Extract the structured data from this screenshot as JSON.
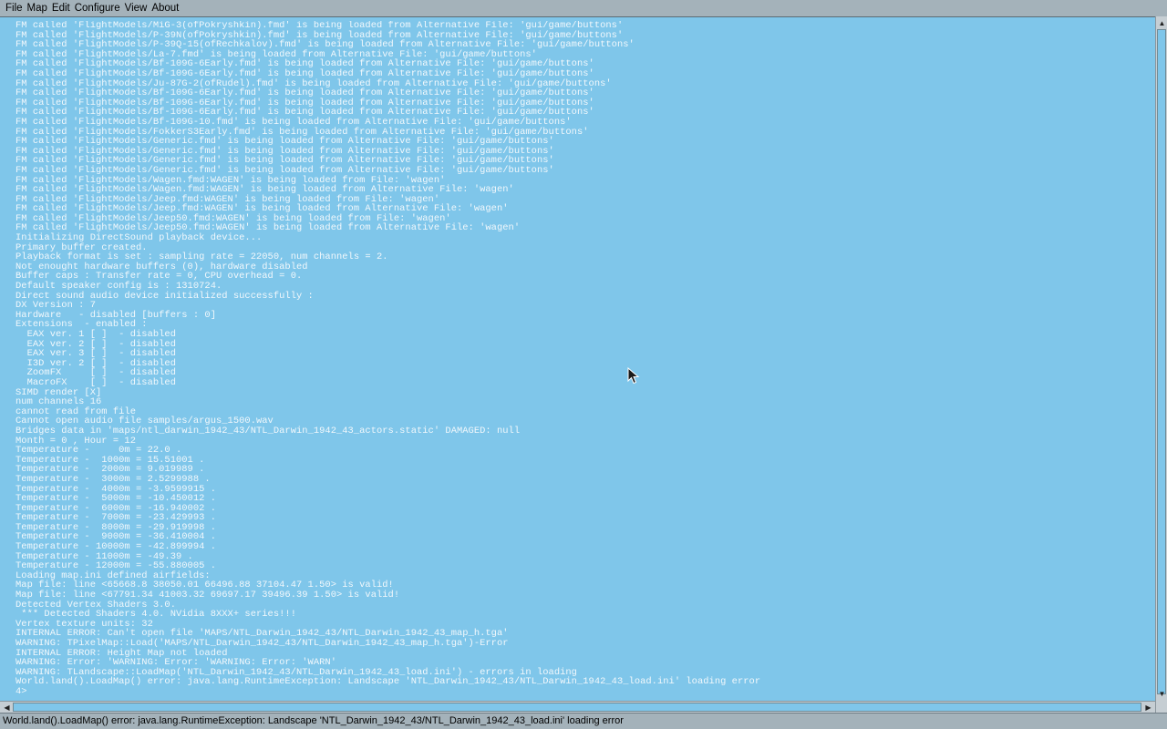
{
  "menu": [
    "File",
    "Map",
    "Edit",
    "Configure",
    "View",
    "About"
  ],
  "console": {
    "lines": [
      "FM called 'FlightModels/MiG-3(ofPokryshkin).fmd' is being loaded from Alternative File: 'gui/game/buttons'",
      "FM called 'FlightModels/P-39N(ofPokryshkin).fmd' is being loaded from Alternative File: 'gui/game/buttons'",
      "FM called 'FlightModels/P-39Q-15(ofRechkalov).fmd' is being loaded from Alternative File: 'gui/game/buttons'",
      "FM called 'FlightModels/La-7.fmd' is being loaded from Alternative File: 'gui/game/buttons'",
      "FM called 'FlightModels/Bf-109G-6Early.fmd' is being loaded from Alternative File: 'gui/game/buttons'",
      "FM called 'FlightModels/Bf-109G-6Early.fmd' is being loaded from Alternative File: 'gui/game/buttons'",
      "FM called 'FlightModels/Ju-87G-2(ofRudel).fmd' is being loaded from Alternative File: 'gui/game/buttons'",
      "FM called 'FlightModels/Bf-109G-6Early.fmd' is being loaded from Alternative File: 'gui/game/buttons'",
      "FM called 'FlightModels/Bf-109G-6Early.fmd' is being loaded from Alternative File: 'gui/game/buttons'",
      "FM called 'FlightModels/Bf-109G-6Early.fmd' is being loaded from Alternative File: 'gui/game/buttons'",
      "FM called 'FlightModels/Bf-109G-10.fmd' is being loaded from Alternative File: 'gui/game/buttons'",
      "FM called 'FlightModels/FokkerS3Early.fmd' is being loaded from Alternative File: 'gui/game/buttons'",
      "FM called 'FlightModels/Generic.fmd' is being loaded from Alternative File: 'gui/game/buttons'",
      "FM called 'FlightModels/Generic.fmd' is being loaded from Alternative File: 'gui/game/buttons'",
      "FM called 'FlightModels/Generic.fmd' is being loaded from Alternative File: 'gui/game/buttons'",
      "FM called 'FlightModels/Generic.fmd' is being loaded from Alternative File: 'gui/game/buttons'",
      "FM called 'FlightModels/Wagen.fmd:WAGEN' is being loaded from File: 'wagen'",
      "FM called 'FlightModels/Wagen.fmd:WAGEN' is being loaded from Alternative File: 'wagen'",
      "FM called 'FlightModels/Jeep.fmd:WAGEN' is being loaded from File: 'wagen'",
      "FM called 'FlightModels/Jeep.fmd:WAGEN' is being loaded from Alternative File: 'wagen'",
      "FM called 'FlightModels/Jeep50.fmd:WAGEN' is being loaded from File: 'wagen'",
      "FM called 'FlightModels/Jeep50.fmd:WAGEN' is being loaded from Alternative File: 'wagen'",
      "Initializing DirectSound playback device...",
      "Primary buffer created.",
      "Playback format is set : sampling rate = 22050, num channels = 2.",
      "Not enought hardware buffers (0), hardware disabled",
      "Buffer caps : Transfer rate = 0, CPU overhead = 0.",
      "Default speaker config is : 1310724.",
      "Direct sound audio device initialized successfully :",
      "DX Version : 7",
      "Hardware   - disabled [buffers : 0]",
      "Extensions  - enabled :",
      "  EAX ver. 1 [ ]  - disabled",
      "  EAX ver. 2 [ ]  - disabled",
      "  EAX ver. 3 [ ]  - disabled",
      "  I3D ver. 2 [ ]  - disabled",
      "  ZoomFX     [ ]  - disabled",
      "  MacroFX    [ ]  - disabled",
      "SIMD render [X]",
      "num channels 16",
      "cannot read from file",
      "Cannot open audio file samples/argus_1500.wav",
      "Bridges data in 'maps/ntl_darwin_1942_43/NTL_Darwin_1942_43_actors.static' DAMAGED: null",
      "Month = 0 , Hour = 12",
      "Temperature -     0m = 22.0 .",
      "Temperature -  1000m = 15.51001 .",
      "Temperature -  2000m = 9.019989 .",
      "Temperature -  3000m = 2.5299988 .",
      "Temperature -  4000m = -3.9599915 .",
      "Temperature -  5000m = -10.450012 .",
      "Temperature -  6000m = -16.940002 .",
      "Temperature -  7000m = -23.429993 .",
      "Temperature -  8000m = -29.919998 .",
      "Temperature -  9000m = -36.410004 .",
      "Temperature - 10000m = -42.899994 .",
      "Temperature - 11000m = -49.39 .",
      "Temperature - 12000m = -55.880005 .",
      "Loading map.ini defined airfields:",
      "Map file: line <65668.8 38050.01 66496.88 37104.47 1.50> is valid!",
      "Map file: line <67791.34 41003.32 69697.17 39496.39 1.50> is valid!",
      "Detected Vertex Shaders 3.0.",
      " *** Detected Shaders 4.0. NVidia 8XXX+ series!!!",
      "Vertex texture units: 32",
      "INTERNAL ERROR: Can't open file 'MAPS/NTL_Darwin_1942_43/NTL_Darwin_1942_43_map_h.tga'",
      "WARNING: TPixelMap::Load('MAPS/NTL_Darwin_1942_43/NTL_Darwin_1942_43_map_h.tga')-Error",
      "INTERNAL ERROR: Height Map not loaded",
      "WARNING: Error: 'WARNING: Error: 'WARNING: Error: 'WARN'",
      "WARNING: TLandscape::LoadMap('NTL_Darwin_1942_43/NTL_Darwin_1942_43_load.ini') - errors in loading",
      "World.land().LoadMap() error: java.lang.RuntimeException: Landscape 'NTL_Darwin_1942_43/NTL_Darwin_1942_43_load.ini' loading error",
      "4>"
    ]
  },
  "scrollbar": {
    "up": "▲",
    "down": "▼",
    "left": "◀",
    "right": "▶"
  },
  "status": {
    "text": "World.land().LoadMap() error: java.lang.RuntimeException: Landscape 'NTL_Darwin_1942_43/NTL_Darwin_1942_43_load.ini' loading error"
  }
}
